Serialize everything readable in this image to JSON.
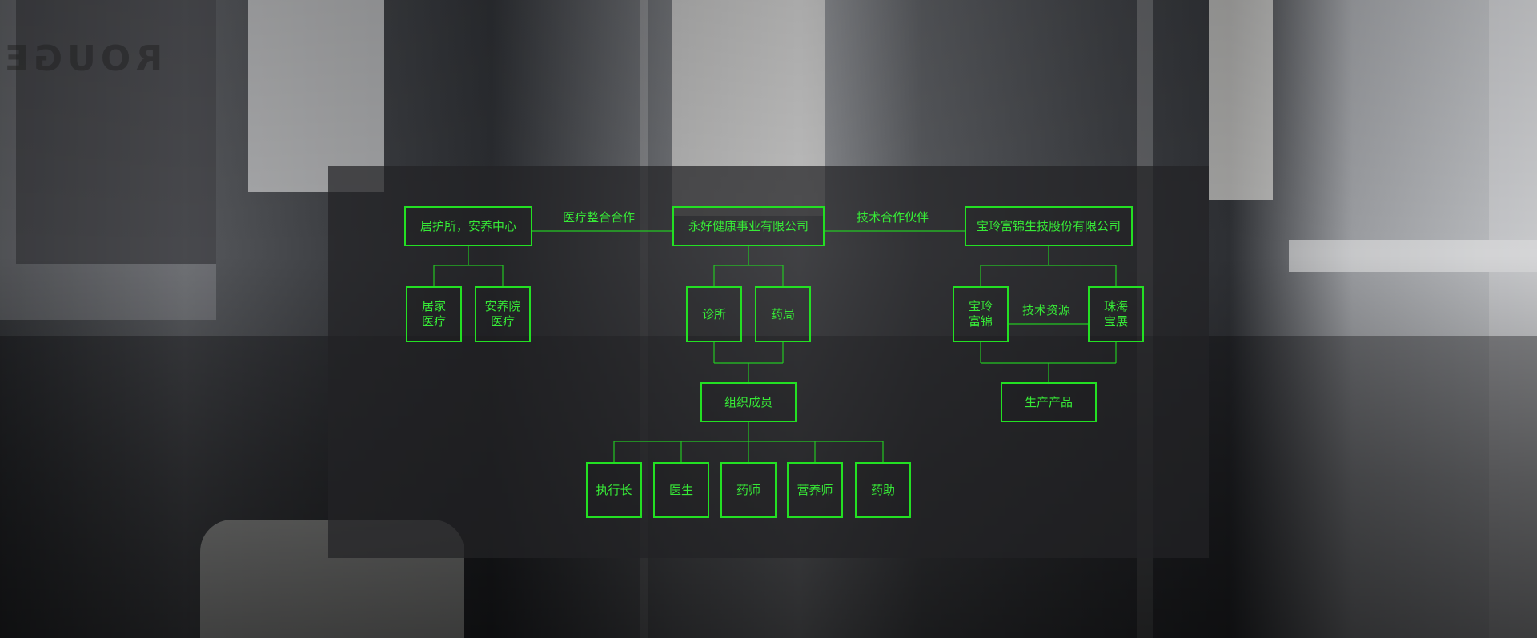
{
  "colors": {
    "accent": "#23e023",
    "panel": "#232325"
  },
  "nodes": {
    "left_main": "居护所，安养中心",
    "left_child_1": "居家\n医疗",
    "left_child_2": "安养院\n医疗",
    "center_main": "永好健康事业有限公司",
    "clinic": "诊所",
    "pharmacy": "药局",
    "members": "组织成员",
    "ceo": "执行长",
    "doctor": "医生",
    "pharmacist": "药师",
    "nutritionist": "营养师",
    "assistant": "药助",
    "right_main": "宝玲富锦生技股份有限公司",
    "right_child_1": "宝玲\n富锦",
    "right_child_2": "珠海\n宝展",
    "products": "生产产品"
  },
  "edge_labels": {
    "medical_integration": "医疗整合合作",
    "tech_partner": "技术合作伙伴",
    "tech_resources": "技术资源"
  }
}
